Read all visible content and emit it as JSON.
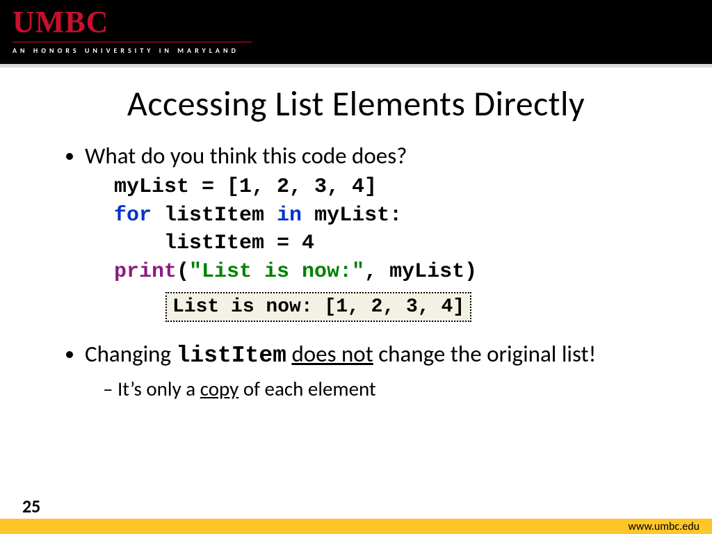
{
  "header": {
    "logo": "UMBC",
    "tagline": "AN HONORS UNIVERSITY IN MARYLAND"
  },
  "title": "Accessing List Elements Directly",
  "bullets": {
    "q": "What do you think this code does?",
    "code": {
      "l1": "myList = [1, 2, 3, 4]",
      "l2_for": "for",
      "l2_mid": " listItem ",
      "l2_in": "in",
      "l2_end": " myList:",
      "l3": "listItem = 4",
      "l4_print": "print",
      "l4_open": "(",
      "l4_str": "\"List is now:\"",
      "l4_rest": ", myList)"
    },
    "output": "List is now: [1, 2, 3, 4]",
    "b2_pre": "Changing ",
    "b2_code": "listItem",
    "b2_mid": " ",
    "b2_ul": "does not",
    "b2_post": " change the original list!",
    "sub_pre": "It’s only a ",
    "sub_ul": "copy",
    "sub_post": " of each element"
  },
  "footer": {
    "page": "25",
    "url": "www.umbc.edu"
  }
}
